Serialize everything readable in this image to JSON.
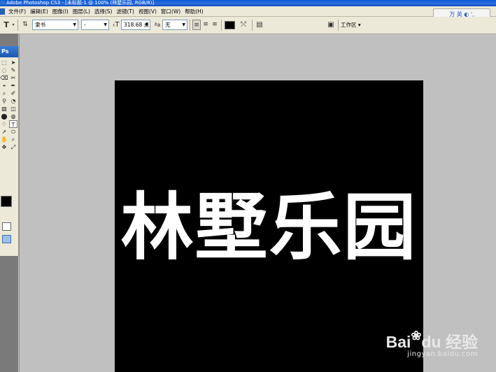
{
  "titlebar": {
    "text": "Adobe Photoshop CS3 - [未标题-1 @ 100% (林墅乐园, RGB/8)]"
  },
  "menu": [
    "文件(F)",
    "编辑(E)",
    "图像(I)",
    "图层(L)",
    "选择(S)",
    "滤镜(T)",
    "视图(V)",
    "窗口(W)",
    "帮助(H)"
  ],
  "ime": {
    "label": "万 英 ◐ ',"
  },
  "options": {
    "tool_glyph": "T",
    "font_family": "隶书",
    "font_style": "-",
    "font_size": "318.68 点",
    "antialias": "无",
    "workspace": "工作区 ▾"
  },
  "toolbox": {
    "logo": "Ps",
    "tools": [
      "⬚",
      "➤",
      "◌",
      "✎",
      "⌫",
      "✂",
      "⌖",
      "✒",
      "⌕",
      "✐",
      "⚲",
      "◔",
      "▧",
      "◫",
      "⬤",
      "◍",
      "♢",
      "T",
      "➚",
      "⬭",
      "✋",
      "⌕",
      "✥",
      "⤢"
    ]
  },
  "canvas": {
    "text": "林墅乐园"
  },
  "watermark": {
    "brand": "Bai",
    "brand2": "du",
    "suffix": "经验",
    "url": "jingyan.baidu.com"
  }
}
